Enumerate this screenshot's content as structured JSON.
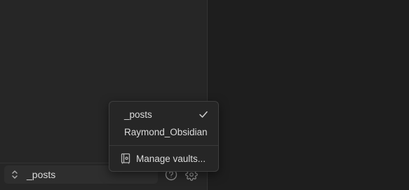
{
  "vault_menu": {
    "items": [
      {
        "label": "_posts",
        "checked": true
      },
      {
        "label": "Raymond_Obsidian",
        "checked": false
      }
    ],
    "manage_label": "Manage vaults...",
    "icons": {
      "check": "check-icon",
      "manage": "vault-icon"
    }
  },
  "bottom_bar": {
    "vault_name": "_posts",
    "icons": {
      "switcher": "chevron-up-down-icon",
      "help": "help-circle-icon",
      "settings": "gear-icon"
    }
  },
  "colors": {
    "sidebar_bg": "#262626",
    "main_bg": "#1e1e1e",
    "menu_bg": "#262626",
    "text": "#dcdcdc",
    "icon": "#9a9a9a"
  }
}
